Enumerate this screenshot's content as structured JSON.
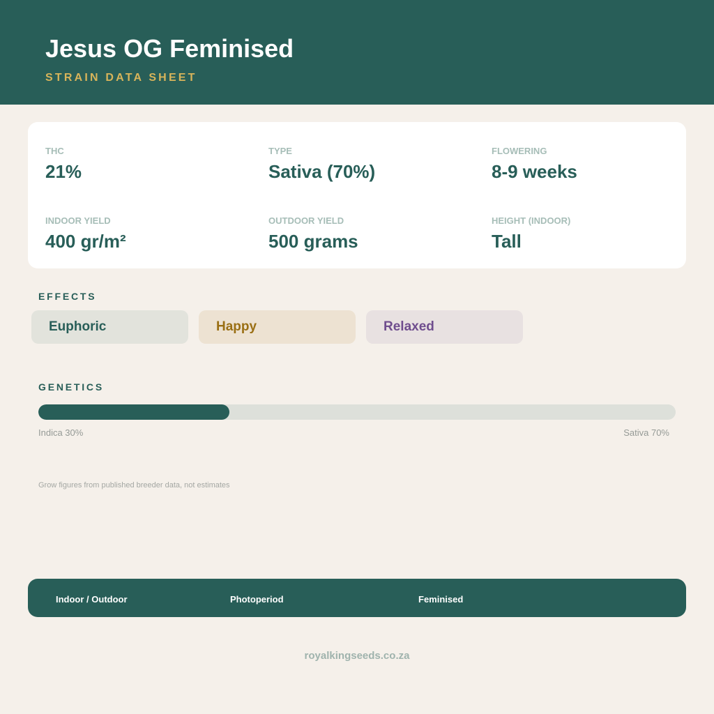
{
  "header": {
    "title": "Jesus OG Feminised",
    "subtitle": "STRAIN DATA SHEET"
  },
  "stats": [
    {
      "label": "THC",
      "value": "21%"
    },
    {
      "label": "TYPE",
      "value": "Sativa (70%)"
    },
    {
      "label": "FLOWERING",
      "value": "8-9 weeks"
    },
    {
      "label": "INDOOR YIELD",
      "value": "400 gr/m²"
    },
    {
      "label": "OUTDOOR YIELD",
      "value": "500 grams"
    },
    {
      "label": "HEIGHT (INDOOR)",
      "value": "Tall"
    }
  ],
  "effects": {
    "label": "EFFECTS",
    "items": [
      {
        "label": "Euphoric",
        "bg": "#e2e3dc",
        "color": "#285e58"
      },
      {
        "label": "Happy",
        "bg": "#ede2d2",
        "color": "#9a6f14"
      },
      {
        "label": "Relaxed",
        "bg": "#e8e1e1",
        "color": "#6f4d8e"
      }
    ]
  },
  "genetics": {
    "label": "GENETICS",
    "indica_percent": 30,
    "sativa_percent": 70,
    "indica_label": "Indica 30%",
    "sativa_label": "Sativa 70%"
  },
  "note": "Grow figures from published breeder data, not estimates",
  "footer": {
    "items": [
      "Indoor / Outdoor",
      "Photoperiod",
      "Feminised"
    ]
  },
  "website": "royalkingseeds.co.za",
  "colors": {
    "brand": "#285e58",
    "accent": "#d8b45a",
    "background": "#f5f0ea"
  }
}
